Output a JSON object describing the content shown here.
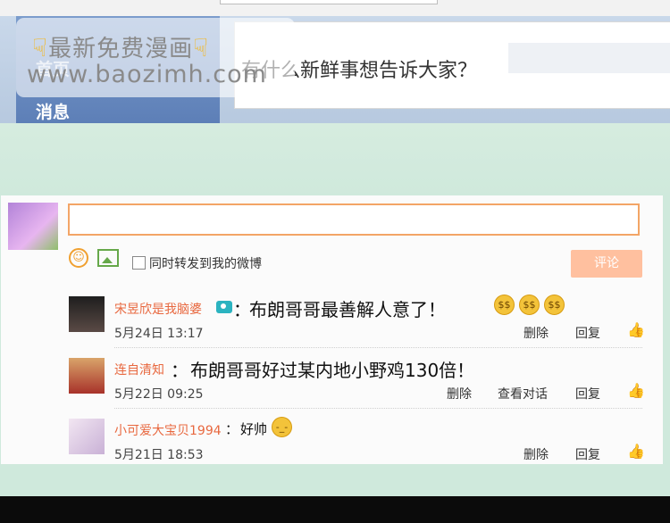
{
  "background_ui": {
    "nav_home": "首页",
    "nav_messages": "消息",
    "compose_prompt": "有什么新鲜事想告诉大家？"
  },
  "watermark": {
    "line1": "最新免费漫画",
    "line2": "www.baozimh.com"
  },
  "composer": {
    "share_checkbox_label": "同时转发到我的微博",
    "post_button": "评论"
  },
  "comments": [
    {
      "user": "宋昱欣是我脑婆",
      "separator": "：",
      "text": "布朗哥哥最善解人意了！",
      "time": "5月24日 13:17",
      "actions": [
        "删除",
        "回复"
      ],
      "emoji_count": 3
    },
    {
      "user": "连自清知",
      "separator": "：",
      "text": "布朗哥哥好过某内地小野鸡130倍！",
      "time": "5月22日 09:25",
      "actions": [
        "删除",
        "查看对话",
        "回复"
      ]
    },
    {
      "user": "小可爱大宝贝1994",
      "separator": "：",
      "text": "好帅",
      "time": "5月21日 18:53",
      "actions": [
        "删除",
        "回复"
      ],
      "emoji_count": 1
    }
  ],
  "colors": {
    "username": "#e8683f",
    "input_border": "#f3a566",
    "post_button": "#ffc09f",
    "mint_background": "#cfe9dc"
  },
  "icons": [
    "smile-icon",
    "image-icon",
    "camera-icon",
    "thumbs-up-icon",
    "pointing-hand-icon"
  ]
}
